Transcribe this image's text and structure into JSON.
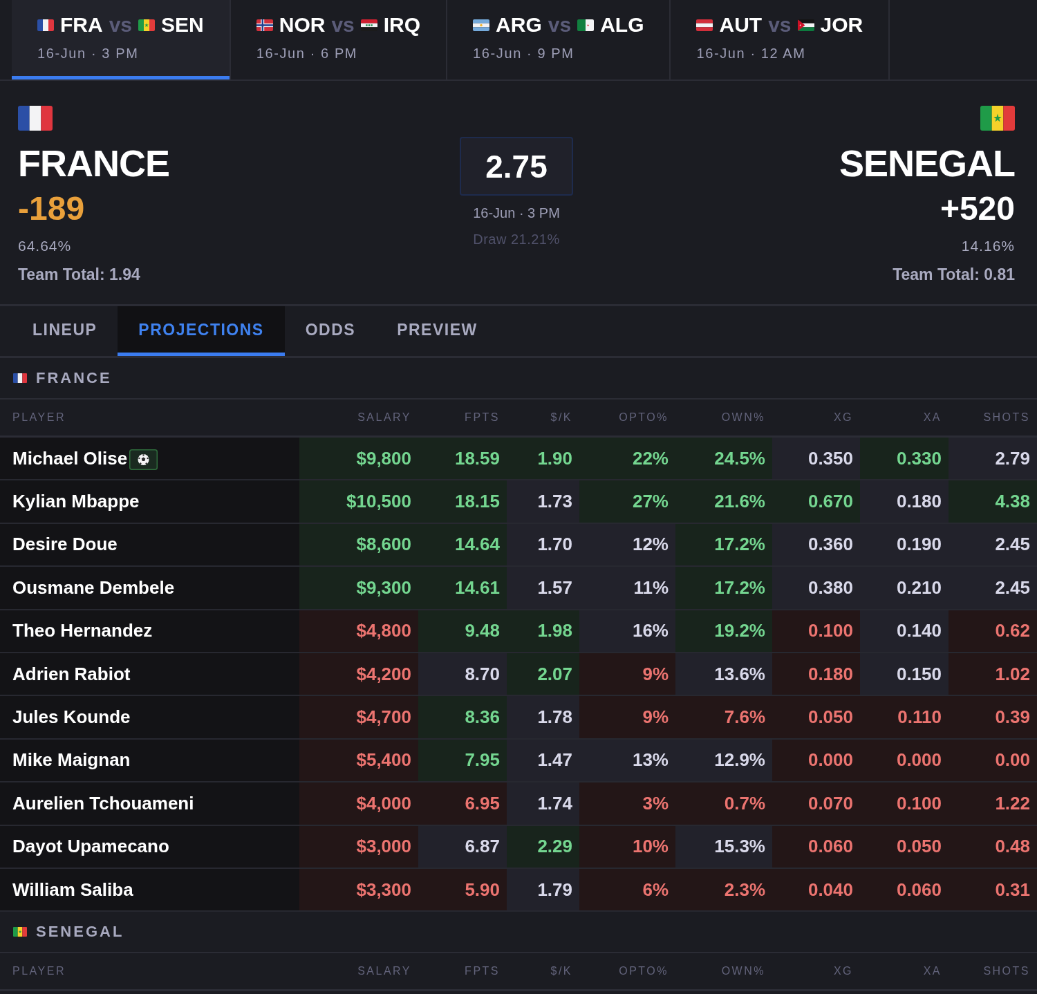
{
  "matches": [
    {
      "home": {
        "kind": "france",
        "code": "FRA"
      },
      "vs": "vs",
      "away": {
        "kind": "senegal",
        "code": "SEN"
      },
      "time": "16-Jun · 3 PM",
      "selected": true
    },
    {
      "home": {
        "kind": "norway",
        "code": "NOR"
      },
      "vs": "vs",
      "away": {
        "kind": "iraq",
        "code": "IRQ"
      },
      "time": "16-Jun · 6 PM",
      "selected": false
    },
    {
      "home": {
        "kind": "argentina",
        "code": "ARG"
      },
      "vs": "vs",
      "away": {
        "kind": "algeria",
        "code": "ALG"
      },
      "time": "16-Jun · 9 PM",
      "selected": false
    },
    {
      "home": {
        "kind": "austria",
        "code": "AUT"
      },
      "vs": "vs",
      "away": {
        "kind": "jordan",
        "code": "JOR"
      },
      "time": "16-Jun · 12 AM",
      "selected": false
    }
  ],
  "header": {
    "home": {
      "kind": "france",
      "name": "FRANCE",
      "odds": "-189",
      "favorite": true,
      "probability": "64.64%",
      "team_total": "Team Total: 1.94"
    },
    "total": "2.75",
    "time": "16-Jun · 3 PM",
    "draw": "Draw 21.21%",
    "away": {
      "kind": "senegal",
      "name": "SENEGAL",
      "odds": "+520",
      "favorite": false,
      "probability": "14.16%",
      "team_total": "Team Total: 0.81"
    }
  },
  "tabs": [
    {
      "label": "LINEUP",
      "selected": false
    },
    {
      "label": "PROJECTIONS",
      "selected": true
    },
    {
      "label": "ODDS",
      "selected": false
    },
    {
      "label": "PREVIEW",
      "selected": false
    }
  ],
  "sections": [
    {
      "kind": "france",
      "name": "FRANCE",
      "player_column": "PLAYER",
      "columns": [
        "SALARY",
        "FPTS",
        "$/K",
        "OPTO%",
        "OWN%",
        "XG",
        "XA",
        "SHOTS"
      ],
      "rows": [
        {
          "name": "Michael Olise",
          "ball_icon": true,
          "cells": [
            {
              "value": "$9,800",
              "kind": "high"
            },
            {
              "value": "18.59",
              "kind": "high"
            },
            {
              "value": "1.90",
              "kind": "high"
            },
            {
              "value": "22%",
              "kind": "high"
            },
            {
              "value": "24.5%",
              "kind": "high"
            },
            {
              "value": "0.350",
              "kind": "mid"
            },
            {
              "value": "0.330",
              "kind": "high"
            },
            {
              "value": "2.79",
              "kind": "mid"
            }
          ]
        },
        {
          "name": "Kylian Mbappe",
          "ball_icon": false,
          "cells": [
            {
              "value": "$10,500",
              "kind": "high"
            },
            {
              "value": "18.15",
              "kind": "high"
            },
            {
              "value": "1.73",
              "kind": "mid"
            },
            {
              "value": "27%",
              "kind": "high"
            },
            {
              "value": "21.6%",
              "kind": "high"
            },
            {
              "value": "0.670",
              "kind": "high"
            },
            {
              "value": "0.180",
              "kind": "mid"
            },
            {
              "value": "4.38",
              "kind": "high"
            }
          ]
        },
        {
          "name": "Desire Doue",
          "ball_icon": false,
          "cells": [
            {
              "value": "$8,600",
              "kind": "high"
            },
            {
              "value": "14.64",
              "kind": "high"
            },
            {
              "value": "1.70",
              "kind": "mid"
            },
            {
              "value": "12%",
              "kind": "mid"
            },
            {
              "value": "17.2%",
              "kind": "high"
            },
            {
              "value": "0.360",
              "kind": "mid"
            },
            {
              "value": "0.190",
              "kind": "mid"
            },
            {
              "value": "2.45",
              "kind": "mid"
            }
          ]
        },
        {
          "name": "Ousmane Dembele",
          "ball_icon": false,
          "cells": [
            {
              "value": "$9,300",
              "kind": "high"
            },
            {
              "value": "14.61",
              "kind": "high"
            },
            {
              "value": "1.57",
              "kind": "mid"
            },
            {
              "value": "11%",
              "kind": "mid"
            },
            {
              "value": "17.2%",
              "kind": "high"
            },
            {
              "value": "0.380",
              "kind": "mid"
            },
            {
              "value": "0.210",
              "kind": "mid"
            },
            {
              "value": "2.45",
              "kind": "mid"
            }
          ]
        },
        {
          "name": "Theo Hernandez",
          "ball_icon": false,
          "cells": [
            {
              "value": "$4,800",
              "kind": "low"
            },
            {
              "value": "9.48",
              "kind": "high"
            },
            {
              "value": "1.98",
              "kind": "high"
            },
            {
              "value": "16%",
              "kind": "mid"
            },
            {
              "value": "19.2%",
              "kind": "high"
            },
            {
              "value": "0.100",
              "kind": "low"
            },
            {
              "value": "0.140",
              "kind": "mid"
            },
            {
              "value": "0.62",
              "kind": "low"
            }
          ]
        },
        {
          "name": "Adrien Rabiot",
          "ball_icon": false,
          "cells": [
            {
              "value": "$4,200",
              "kind": "low"
            },
            {
              "value": "8.70",
              "kind": "mid"
            },
            {
              "value": "2.07",
              "kind": "high"
            },
            {
              "value": "9%",
              "kind": "low"
            },
            {
              "value": "13.6%",
              "kind": "mid"
            },
            {
              "value": "0.180",
              "kind": "low"
            },
            {
              "value": "0.150",
              "kind": "mid"
            },
            {
              "value": "1.02",
              "kind": "low"
            }
          ]
        },
        {
          "name": "Jules Kounde",
          "ball_icon": false,
          "cells": [
            {
              "value": "$4,700",
              "kind": "low"
            },
            {
              "value": "8.36",
              "kind": "high"
            },
            {
              "value": "1.78",
              "kind": "mid"
            },
            {
              "value": "9%",
              "kind": "low"
            },
            {
              "value": "7.6%",
              "kind": "low"
            },
            {
              "value": "0.050",
              "kind": "low"
            },
            {
              "value": "0.110",
              "kind": "low"
            },
            {
              "value": "0.39",
              "kind": "low"
            }
          ]
        },
        {
          "name": "Mike Maignan",
          "ball_icon": false,
          "cells": [
            {
              "value": "$5,400",
              "kind": "low"
            },
            {
              "value": "7.95",
              "kind": "high"
            },
            {
              "value": "1.47",
              "kind": "mid"
            },
            {
              "value": "13%",
              "kind": "mid"
            },
            {
              "value": "12.9%",
              "kind": "mid"
            },
            {
              "value": "0.000",
              "kind": "low"
            },
            {
              "value": "0.000",
              "kind": "low"
            },
            {
              "value": "0.00",
              "kind": "low"
            }
          ]
        },
        {
          "name": "Aurelien Tchouameni",
          "ball_icon": false,
          "cells": [
            {
              "value": "$4,000",
              "kind": "low"
            },
            {
              "value": "6.95",
              "kind": "low"
            },
            {
              "value": "1.74",
              "kind": "mid"
            },
            {
              "value": "3%",
              "kind": "low"
            },
            {
              "value": "0.7%",
              "kind": "low"
            },
            {
              "value": "0.070",
              "kind": "low"
            },
            {
              "value": "0.100",
              "kind": "low"
            },
            {
              "value": "1.22",
              "kind": "low"
            }
          ]
        },
        {
          "name": "Dayot Upamecano",
          "ball_icon": false,
          "cells": [
            {
              "value": "$3,000",
              "kind": "low"
            },
            {
              "value": "6.87",
              "kind": "mid"
            },
            {
              "value": "2.29",
              "kind": "high"
            },
            {
              "value": "10%",
              "kind": "low"
            },
            {
              "value": "15.3%",
              "kind": "mid"
            },
            {
              "value": "0.060",
              "kind": "low"
            },
            {
              "value": "0.050",
              "kind": "low"
            },
            {
              "value": "0.48",
              "kind": "low"
            }
          ]
        },
        {
          "name": "William Saliba",
          "ball_icon": false,
          "cells": [
            {
              "value": "$3,300",
              "kind": "low"
            },
            {
              "value": "5.90",
              "kind": "low"
            },
            {
              "value": "1.79",
              "kind": "mid"
            },
            {
              "value": "6%",
              "kind": "low"
            },
            {
              "value": "2.3%",
              "kind": "low"
            },
            {
              "value": "0.040",
              "kind": "low"
            },
            {
              "value": "0.060",
              "kind": "low"
            },
            {
              "value": "0.31",
              "kind": "low"
            }
          ]
        }
      ]
    },
    {
      "kind": "senegal",
      "name": "SENEGAL",
      "player_column": "PLAYER",
      "columns": [
        "SALARY",
        "FPTS",
        "$/K",
        "OPTO%",
        "OWN%",
        "XG",
        "XA",
        "SHOTS"
      ]
    }
  ]
}
